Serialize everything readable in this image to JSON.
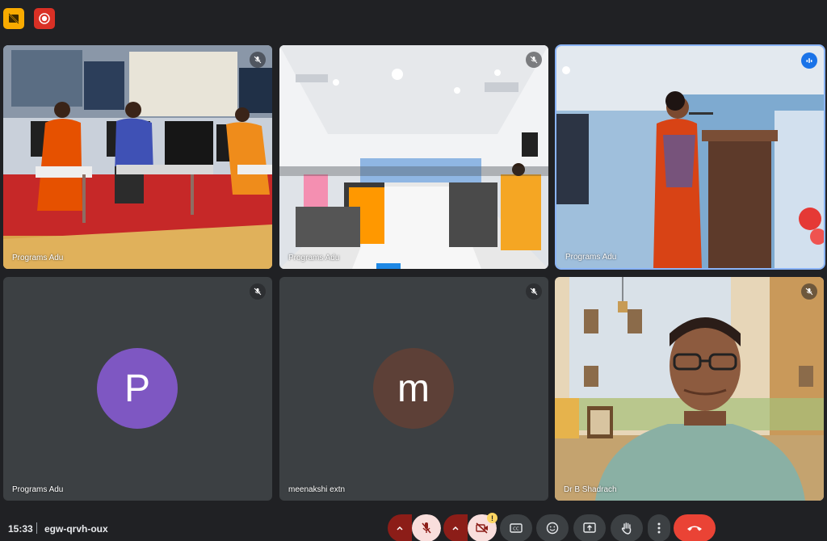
{
  "top": {
    "left_icon": "no-video-file-icon",
    "right_icon": "recording-icon",
    "colors": {
      "left": "#f9ab00",
      "right": "#d93025"
    }
  },
  "tiles": [
    {
      "name": "Programs Adu",
      "state": "muted",
      "kind": "video",
      "scene": "stage-panel"
    },
    {
      "name": "Programs Adu",
      "state": "muted",
      "kind": "video",
      "scene": "auditorium-audience"
    },
    {
      "name": "Programs Adu",
      "state": "speaking",
      "kind": "video",
      "scene": "speaker-at-podium"
    },
    {
      "name": "Programs Adu",
      "state": "muted",
      "kind": "avatar",
      "initial": "P",
      "color": "#7e57c2"
    },
    {
      "name": "meenakshi extn",
      "state": "muted",
      "kind": "avatar",
      "initial": "m",
      "color": "#5d4037"
    },
    {
      "name": "Dr B Shadrach",
      "state": "muted",
      "kind": "video",
      "scene": "man-with-glasses"
    }
  ],
  "bottom": {
    "time": "15:33",
    "meeting_code": "egw-qrvh-oux",
    "controls": [
      {
        "icon": "mic-off-icon",
        "label": "Microphone off"
      },
      {
        "icon": "camera-off-icon",
        "label": "Camera off",
        "warning": "!"
      },
      {
        "icon": "captions-icon"
      },
      {
        "icon": "emoji-icon"
      },
      {
        "icon": "present-screen-icon"
      },
      {
        "icon": "raise-hand-icon"
      },
      {
        "icon": "more-options-icon"
      },
      {
        "icon": "hang-up-icon"
      }
    ]
  }
}
